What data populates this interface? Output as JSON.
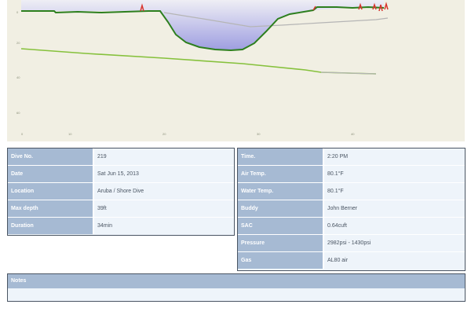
{
  "profile": {
    "y_scale": [
      "0",
      "20",
      "40",
      "60"
    ],
    "x_scale": [
      "0",
      "10",
      "20",
      "30",
      "40"
    ]
  },
  "details_left": [
    {
      "label": "Dive No.",
      "value": "219"
    },
    {
      "label": "Date",
      "value": "Sat Jun 15, 2013"
    },
    {
      "label": "Location",
      "value": "Aruba / Shore Dive"
    },
    {
      "label": "Max depth",
      "value": "39ft"
    },
    {
      "label": "Duration",
      "value": "34min"
    }
  ],
  "details_right": [
    {
      "label": "Time.",
      "value": "2:20 PM"
    },
    {
      "label": "Air Temp.",
      "value": "80.1°F"
    },
    {
      "label": "Water Temp.",
      "value": "80.1°F"
    },
    {
      "label": "Buddy",
      "value": "John Berner"
    },
    {
      "label": "SAC",
      "value": "0.64cuft"
    },
    {
      "label": "Pressure",
      "value": "2982psi - 1430psi"
    },
    {
      "label": "Gas",
      "value": "AL80 air"
    }
  ],
  "notes": {
    "label": "Notes",
    "body": ""
  },
  "colors": {
    "label_bg": "#a6bad3",
    "value_bg": "#eef4fa",
    "profile_bg": "#f1efe3",
    "depth_line": "#2d7f1e",
    "ascent_warn": "#d8362e",
    "pressure_line": "#86c13c",
    "temp_line": "#b5b5b5"
  }
}
